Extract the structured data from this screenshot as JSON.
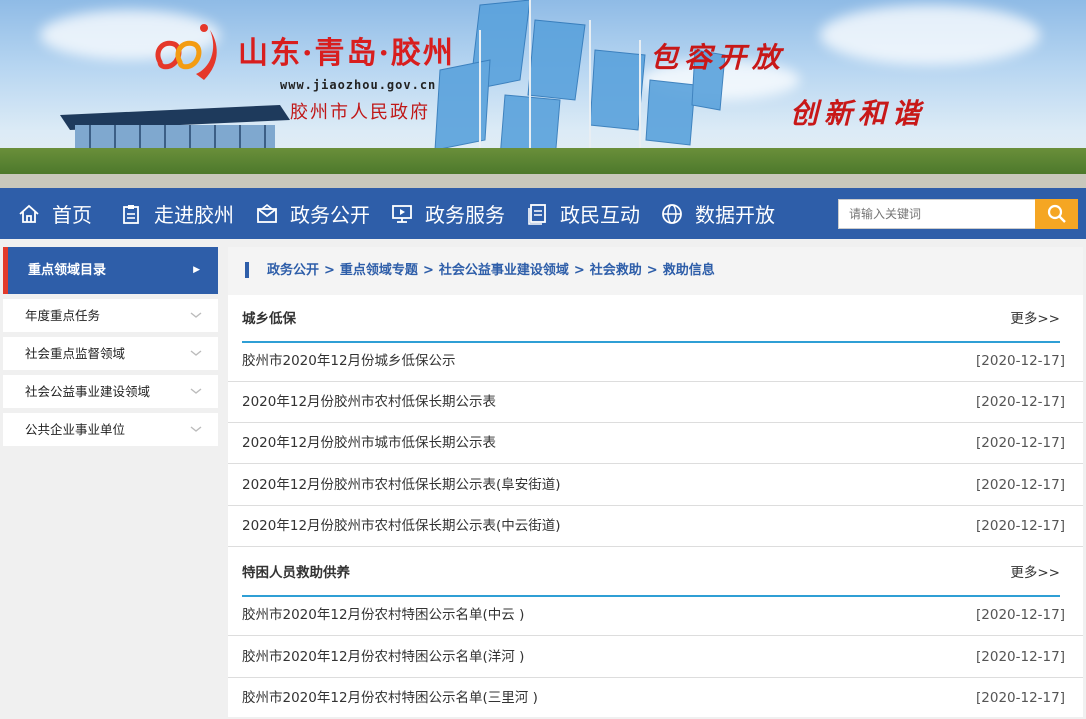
{
  "banner": {
    "title": "山东·青岛·胶州",
    "url": "www.jiaozhou.gov.cn",
    "gov_name": "胶州市人民政府",
    "slogan1": "包容开放",
    "slogan2": "创新和谐"
  },
  "nav": {
    "items": [
      {
        "label": "首页",
        "icon": "home-icon"
      },
      {
        "label": "走进胶州",
        "icon": "clipboard-icon"
      },
      {
        "label": "政务公开",
        "icon": "mail-icon"
      },
      {
        "label": "政务服务",
        "icon": "monitor-icon"
      },
      {
        "label": "政民互动",
        "icon": "document-icon"
      },
      {
        "label": "数据开放",
        "icon": "globe-icon"
      }
    ],
    "search_placeholder": "请输入关键词"
  },
  "sidebar": {
    "title": "重点领域目录",
    "items": [
      {
        "label": "年度重点任务"
      },
      {
        "label": "社会重点监督领域"
      },
      {
        "label": "社会公益事业建设领域"
      },
      {
        "label": "公共企业事业单位"
      }
    ]
  },
  "breadcrumb": [
    "政务公开",
    "重点领域专题",
    "社会公益事业建设领域",
    "社会救助",
    "救助信息"
  ],
  "sections": [
    {
      "title": "城乡低保",
      "more": "更多>>",
      "rows": [
        {
          "title": "胶州市2020年12月份城乡低保公示",
          "date": "[2020-12-17]"
        },
        {
          "title": "2020年12月份胶州市农村低保长期公示表",
          "date": "[2020-12-17]"
        },
        {
          "title": "2020年12月份胶州市城市低保长期公示表",
          "date": "[2020-12-17]"
        },
        {
          "title": "2020年12月份胶州市农村低保长期公示表(阜安街道)",
          "date": "[2020-12-17]"
        },
        {
          "title": "2020年12月份胶州市农村低保长期公示表(中云街道)",
          "date": "[2020-12-17]"
        }
      ]
    },
    {
      "title": "特困人员救助供养",
      "more": "更多>>",
      "rows": [
        {
          "title": "胶州市2020年12月份农村特困公示名单(中云 )",
          "date": "[2020-12-17]"
        },
        {
          "title": "胶州市2020年12月份农村特困公示名单(洋河 )",
          "date": "[2020-12-17]"
        },
        {
          "title": "胶州市2020年12月份农村特困公示名单(三里河 )",
          "date": "[2020-12-17]"
        }
      ]
    }
  ],
  "colors": {
    "nav_bg": "#2e5ea9",
    "accent_red": "#e23a2a",
    "search_button": "#f5a623",
    "section_rule": "#2f9fd5"
  }
}
